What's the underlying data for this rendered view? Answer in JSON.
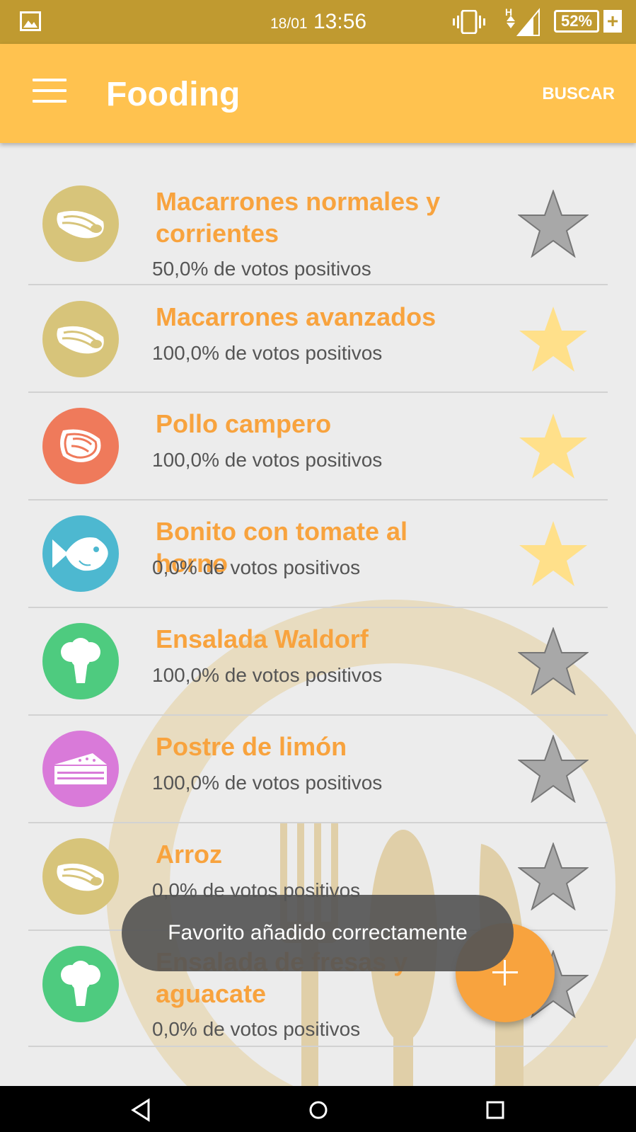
{
  "status_bar": {
    "date": "18/01",
    "time": "13:56",
    "battery": "52%",
    "network": "H",
    "icons": [
      "image-icon",
      "vibrate-icon",
      "signal-icon",
      "battery-icon",
      "charging-plus-icon"
    ]
  },
  "app_bar": {
    "title": "Fooding",
    "search_label": "BUSCAR",
    "menu_icon": "hamburger-menu-icon"
  },
  "dishes": [
    {
      "name": "Macarrones normales y corrientes",
      "votes": "50,0% de votos positivos",
      "category_icon": "pasta-icon",
      "circle_color": "#d7c47a",
      "favorite": false
    },
    {
      "name": "Macarrones avanzados",
      "votes": "100,0% de votos positivos",
      "category_icon": "pasta-icon",
      "circle_color": "#d7c47a",
      "favorite": true
    },
    {
      "name": "Pollo campero",
      "votes": "100,0% de votos positivos",
      "category_icon": "meat-icon",
      "circle_color": "#ef7a5b",
      "favorite": true
    },
    {
      "name": "Bonito con tomate al horno",
      "votes": "0,0% de votos positivos",
      "category_icon": "fish-icon",
      "circle_color": "#4db8d0",
      "favorite": true
    },
    {
      "name": "Ensalada Waldorf",
      "votes": "100,0% de votos positivos",
      "category_icon": "broccoli-icon",
      "circle_color": "#4ecb7f",
      "favorite": false
    },
    {
      "name": "Postre de limón",
      "votes": "100,0% de votos positivos",
      "category_icon": "cake-icon",
      "circle_color": "#d97ad9",
      "favorite": false
    },
    {
      "name": "Arroz",
      "votes": "0,0% de votos positivos",
      "category_icon": "pasta-icon",
      "circle_color": "#d7c47a",
      "favorite": false
    },
    {
      "name": "Ensalada de fresas y aguacate",
      "votes": "0,0% de votos positivos",
      "category_icon": "broccoli-icon",
      "circle_color": "#4ecb7f",
      "favorite": false
    }
  ],
  "toast": "Favorito añadido correctamente",
  "fab_icon": "add-icon",
  "colors": {
    "status_bar": "#c09a30",
    "app_bar": "#ffc24f",
    "accent": "#f8a33e",
    "star_favorite": "#ffe08a",
    "star_default": "#a8a8a8"
  },
  "nav_icons": [
    "back-icon",
    "home-icon",
    "recents-icon"
  ]
}
